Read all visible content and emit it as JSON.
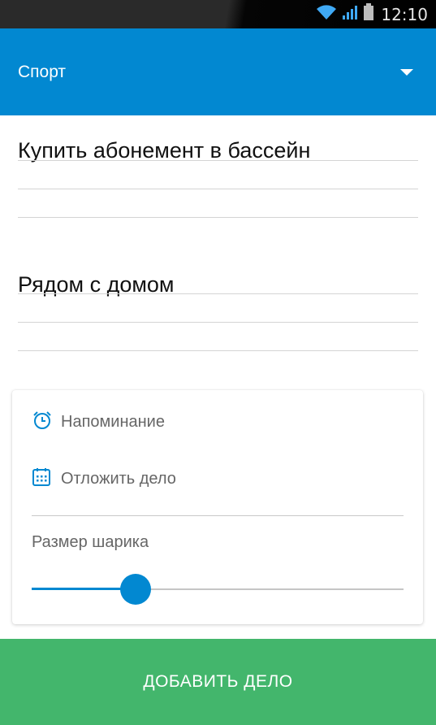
{
  "status_bar": {
    "time": "12:10",
    "icons": [
      "wifi-icon",
      "signal-icon",
      "battery-icon"
    ]
  },
  "toolbar": {
    "category": "Спорт",
    "dropdown_icon": "triangle-down-icon"
  },
  "task": {
    "title": "Купить абонемент в бассейн",
    "note": "Рядом с домом"
  },
  "options": {
    "reminder_label": "Напоминание",
    "reminder_icon": "alarm-clock-icon",
    "postpone_label": "Отложить дело",
    "postpone_icon": "calendar-icon",
    "ball_size_label": "Размер шарика",
    "ball_size_value": 0.28
  },
  "actions": {
    "add_label": "ДОБАВИТЬ ДЕЛО"
  },
  "colors": {
    "primary": "#0288d1",
    "accent_green": "#43b66c",
    "status_icon": "#3fa9f5"
  }
}
